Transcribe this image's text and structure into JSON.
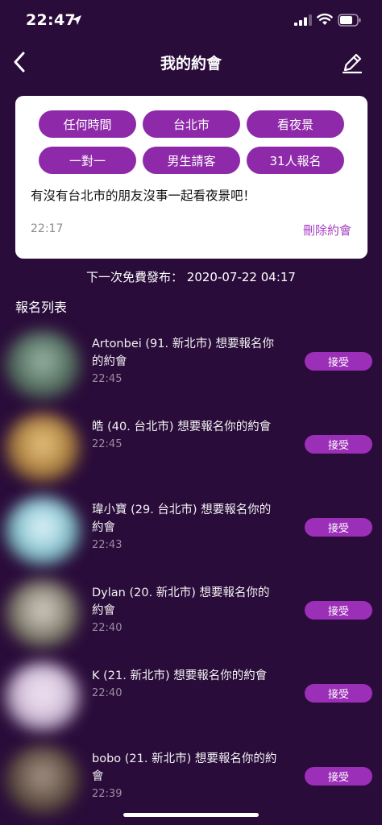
{
  "status_bar": {
    "time": "22:47"
  },
  "nav": {
    "title": "我的約會"
  },
  "date_card": {
    "tags": [
      "任何時間",
      "台北市",
      "看夜景",
      "一對一",
      "男生請客",
      "31人報名"
    ],
    "message": "有沒有台北市的朋友沒事一起看夜景吧！",
    "time": "22:17",
    "delete_label": "刪除約會"
  },
  "next_publish": "下一次免費發布： 2020-07-22 04:17",
  "list_title": "報名列表",
  "applicants": [
    {
      "line1": "Artonbei (91. 新北市) 想要報名你",
      "line2": "的約會",
      "time": "22:45",
      "accept": "接受",
      "avatar_color": "#6f8a7f"
    },
    {
      "line1": "皓 (40. 台北市) 想要報名你的約會",
      "line2": "",
      "time": "22:45",
      "accept": "接受",
      "avatar_color": "#c8a05a"
    },
    {
      "line1": "瑋小寶 (29. 台北市) 想要報名你的",
      "line2": "約會",
      "time": "22:43",
      "accept": "接受",
      "avatar_color": "#9ad1e0"
    },
    {
      "line1": "Dylan (20. 新北市) 想要報名你的",
      "line2": "約會",
      "time": "22:40",
      "accept": "接受",
      "avatar_color": "#8d8a7e"
    },
    {
      "line1": "K (21. 新北市) 想要報名你的約會",
      "line2": "",
      "time": "22:40",
      "accept": "接受",
      "avatar_color": "#d6c6e0"
    },
    {
      "line1": "bobo (21. 新北市) 想要報名你的約",
      "line2": "會",
      "time": "22:39",
      "accept": "接受",
      "avatar_color": "#6a5a50"
    }
  ]
}
